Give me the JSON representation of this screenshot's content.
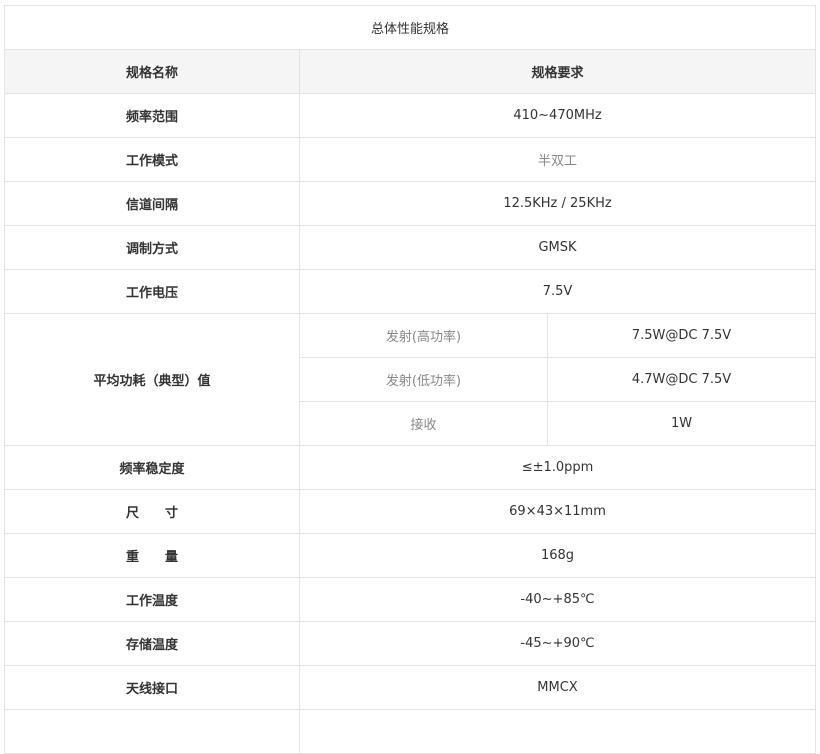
{
  "table": {
    "title": "总体性能规格",
    "header": {
      "name": "规格名称",
      "requirement": "规格要求"
    },
    "rows": {
      "freq_range": {
        "name": "频率范围",
        "value": "410~470MHz"
      },
      "work_mode": {
        "name": "工作模式",
        "value": "半双工"
      },
      "channel": {
        "name": "信道间隔",
        "value": "12.5KHz / 25KHz"
      },
      "modulation": {
        "name": "调制方式",
        "value": "GMSK"
      },
      "voltage": {
        "name": "工作电压",
        "value": "7.5V"
      },
      "power": {
        "name": "平均功耗（典型）值",
        "sub": [
          {
            "label": "发射(高功率)",
            "value": "7.5W@DC 7.5V"
          },
          {
            "label": "发射(低功率)",
            "value": "4.7W@DC 7.5V"
          },
          {
            "label": "接收",
            "value": "1W"
          }
        ]
      },
      "stability": {
        "name": "频率稳定度",
        "value": "≤±1.0ppm"
      },
      "size": {
        "name": "尺　　寸",
        "value": "69×43×11mm"
      },
      "weight": {
        "name": "重　　量",
        "value": "168g"
      },
      "work_temp": {
        "name": "工作温度",
        "value": "-40~+85℃"
      },
      "storage_temp": {
        "name": "存储温度",
        "value": "-45~+90℃"
      },
      "antenna": {
        "name": "天线接口",
        "value": "MMCX"
      }
    }
  }
}
